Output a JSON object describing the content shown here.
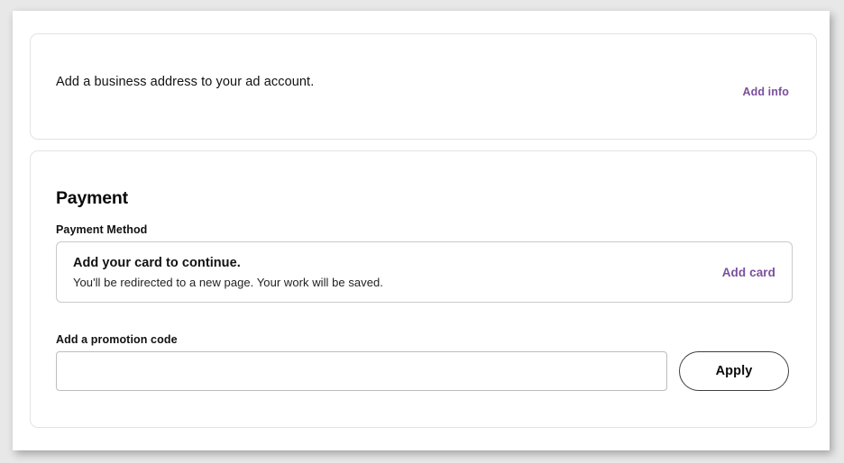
{
  "page": {
    "background_color": "#e8e8e8",
    "surface_color": "#ffffff"
  },
  "theme": {
    "link_purple": "#7a4f9c",
    "text_primary": "#111111",
    "border_gray": "#c9c9c9"
  },
  "address_card": {
    "message": "Add a business address to your ad account.",
    "action_label": "Add info"
  },
  "payment_card": {
    "heading": "Payment",
    "payment_method_label": "Payment Method",
    "card_prompt": {
      "title": "Add your card to continue.",
      "subtitle": "You'll be redirected to a new page. Your work will be saved.",
      "action_label": "Add card"
    },
    "promotion": {
      "label": "Add a promotion code",
      "input_value": "",
      "input_placeholder": "",
      "apply_label": "Apply"
    }
  }
}
